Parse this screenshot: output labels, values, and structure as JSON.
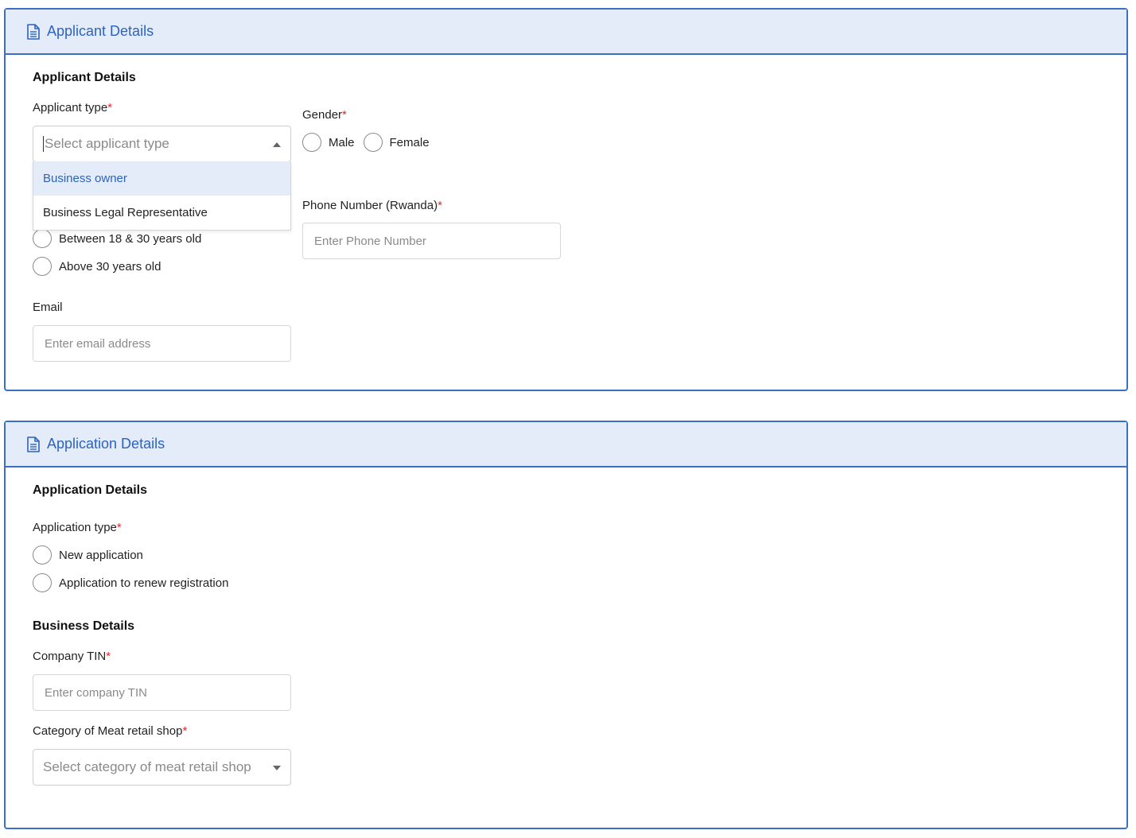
{
  "applicant_panel": {
    "header_title": "Applicant Details",
    "section_title": "Applicant Details",
    "applicant_type": {
      "label": "Applicant type",
      "required_mark": "*",
      "placeholder": "Select applicant type",
      "options": [
        "Business owner",
        "Business Legal Representative"
      ],
      "highlighted_option": "Business owner"
    },
    "gender": {
      "label": "Gender",
      "required_mark": "*",
      "options": [
        "Male",
        "Female"
      ]
    },
    "age_options": [
      "Between 18 & 30 years old",
      "Above 30 years old"
    ],
    "phone": {
      "label": "Phone Number (Rwanda)",
      "required_mark": "*",
      "placeholder": "Enter Phone Number"
    },
    "email": {
      "label": "Email",
      "placeholder": "Enter email address"
    }
  },
  "application_panel": {
    "header_title": "Application Details",
    "section_title": "Application Details",
    "application_type": {
      "label": "Application type",
      "required_mark": "*",
      "options": [
        "New application",
        "Application to renew registration"
      ]
    },
    "business_section_title": "Business Details",
    "company_tin": {
      "label": "Company TIN",
      "required_mark": "*",
      "placeholder": "Enter company TIN"
    },
    "meat_shop_category": {
      "label": "Category of Meat retail shop",
      "required_mark": "*",
      "placeholder": "Select category of meat retail shop"
    }
  },
  "colors": {
    "accent": "#2d63c0",
    "header_bg": "#e3ecf8",
    "border": "#3a6fc4",
    "required": "#e02a2a"
  },
  "icons": {
    "panel_header": "document-icon"
  }
}
